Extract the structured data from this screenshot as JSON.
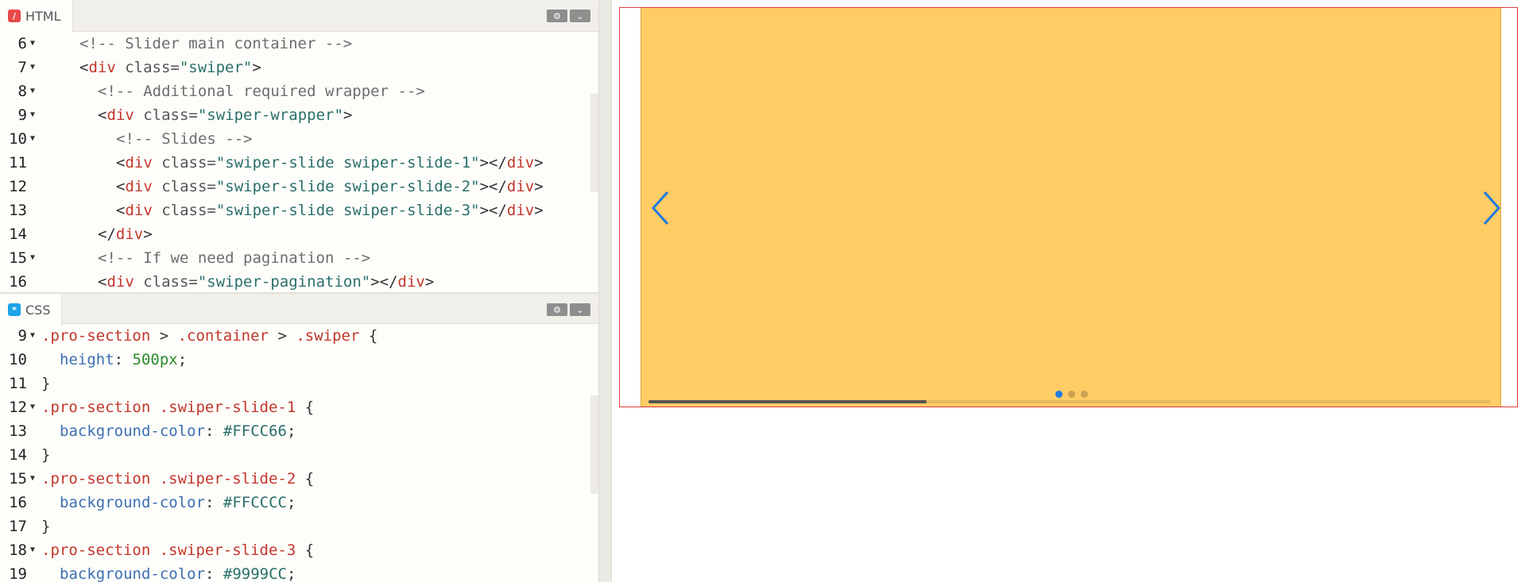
{
  "html_panel": {
    "tab_label": "HTML",
    "icon": "html-icon",
    "lines": [
      {
        "n": "6",
        "fold": true,
        "indent": 4,
        "parts": [
          [
            "c-comment",
            "<!-- Slider main container -->"
          ]
        ]
      },
      {
        "n": "7",
        "fold": true,
        "indent": 4,
        "parts": [
          [
            "c-punc",
            "<"
          ],
          [
            "c-tag",
            "div"
          ],
          [
            "c-attr",
            " class="
          ],
          [
            "c-str",
            "\"swiper\""
          ],
          [
            "c-punc",
            ">"
          ]
        ]
      },
      {
        "n": "8",
        "fold": true,
        "indent": 6,
        "parts": [
          [
            "c-comment",
            "<!-- Additional required wrapper -->"
          ]
        ]
      },
      {
        "n": "9",
        "fold": true,
        "indent": 6,
        "parts": [
          [
            "c-punc",
            "<"
          ],
          [
            "c-tag",
            "div"
          ],
          [
            "c-attr",
            " class="
          ],
          [
            "c-str",
            "\"swiper-wrapper\""
          ],
          [
            "c-punc",
            ">"
          ]
        ]
      },
      {
        "n": "10",
        "fold": true,
        "indent": 8,
        "parts": [
          [
            "c-comment",
            "<!-- Slides -->"
          ]
        ]
      },
      {
        "n": "11",
        "fold": false,
        "indent": 8,
        "parts": [
          [
            "c-punc",
            "<"
          ],
          [
            "c-tag",
            "div"
          ],
          [
            "c-attr",
            " class="
          ],
          [
            "c-str",
            "\"swiper-slide swiper-slide-1\""
          ],
          [
            "c-punc",
            "></"
          ],
          [
            "c-tag",
            "div"
          ],
          [
            "c-punc",
            ">"
          ]
        ]
      },
      {
        "n": "12",
        "fold": false,
        "indent": 8,
        "parts": [
          [
            "c-punc",
            "<"
          ],
          [
            "c-tag",
            "div"
          ],
          [
            "c-attr",
            " class="
          ],
          [
            "c-str",
            "\"swiper-slide swiper-slide-2\""
          ],
          [
            "c-punc",
            "></"
          ],
          [
            "c-tag",
            "div"
          ],
          [
            "c-punc",
            ">"
          ]
        ]
      },
      {
        "n": "13",
        "fold": false,
        "indent": 8,
        "parts": [
          [
            "c-punc",
            "<"
          ],
          [
            "c-tag",
            "div"
          ],
          [
            "c-attr",
            " class="
          ],
          [
            "c-str",
            "\"swiper-slide swiper-slide-3\""
          ],
          [
            "c-punc",
            "></"
          ],
          [
            "c-tag",
            "div"
          ],
          [
            "c-punc",
            ">"
          ]
        ]
      },
      {
        "n": "14",
        "fold": false,
        "indent": 6,
        "parts": [
          [
            "c-punc",
            "</"
          ],
          [
            "c-tag",
            "div"
          ],
          [
            "c-punc",
            ">"
          ]
        ]
      },
      {
        "n": "15",
        "fold": true,
        "indent": 6,
        "parts": [
          [
            "c-comment",
            "<!-- If we need pagination -->"
          ]
        ]
      },
      {
        "n": "16",
        "fold": false,
        "indent": 6,
        "parts": [
          [
            "c-punc",
            "<"
          ],
          [
            "c-tag",
            "div"
          ],
          [
            "c-attr",
            " class="
          ],
          [
            "c-str",
            "\"swiper-pagination\""
          ],
          [
            "c-punc",
            "></"
          ],
          [
            "c-tag",
            "div"
          ],
          [
            "c-punc",
            ">"
          ]
        ]
      }
    ]
  },
  "css_panel": {
    "tab_label": "CSS",
    "icon": "css-icon",
    "lines": [
      {
        "n": "9",
        "fold": true,
        "indent": 0,
        "parts": [
          [
            "c-sel",
            ".pro-section"
          ],
          [
            "c-punc",
            " > "
          ],
          [
            "c-sel",
            ".container"
          ],
          [
            "c-punc",
            " > "
          ],
          [
            "c-sel",
            ".swiper"
          ],
          [
            "c-punc",
            " {"
          ]
        ]
      },
      {
        "n": "10",
        "fold": false,
        "indent": 2,
        "parts": [
          [
            "c-prop",
            "height"
          ],
          [
            "c-punc",
            ": "
          ],
          [
            "c-num",
            "500px"
          ],
          [
            "c-punc",
            ";"
          ]
        ]
      },
      {
        "n": "11",
        "fold": false,
        "indent": 0,
        "parts": [
          [
            "c-punc",
            "}"
          ]
        ]
      },
      {
        "n": "12",
        "fold": true,
        "indent": 0,
        "parts": [
          [
            "c-sel",
            ".pro-section .swiper-slide-1"
          ],
          [
            "c-punc",
            " {"
          ]
        ]
      },
      {
        "n": "13",
        "fold": false,
        "indent": 2,
        "parts": [
          [
            "c-prop",
            "background-color"
          ],
          [
            "c-punc",
            ": "
          ],
          [
            "c-val",
            "#FFCC66"
          ],
          [
            "c-punc",
            ";"
          ]
        ]
      },
      {
        "n": "14",
        "fold": false,
        "indent": 0,
        "parts": [
          [
            "c-punc",
            "}"
          ]
        ]
      },
      {
        "n": "15",
        "fold": true,
        "indent": 0,
        "parts": [
          [
            "c-sel",
            ".pro-section .swiper-slide-2"
          ],
          [
            "c-punc",
            " {"
          ]
        ]
      },
      {
        "n": "16",
        "fold": false,
        "indent": 2,
        "parts": [
          [
            "c-prop",
            "background-color"
          ],
          [
            "c-punc",
            ": "
          ],
          [
            "c-val",
            "#FFCCCC"
          ],
          [
            "c-punc",
            ";"
          ]
        ]
      },
      {
        "n": "17",
        "fold": false,
        "indent": 0,
        "parts": [
          [
            "c-punc",
            "}"
          ]
        ]
      },
      {
        "n": "18",
        "fold": true,
        "indent": 0,
        "parts": [
          [
            "c-sel",
            ".pro-section .swiper-slide-3"
          ],
          [
            "c-punc",
            " {"
          ]
        ]
      },
      {
        "n": "19",
        "fold": false,
        "indent": 2,
        "parts": [
          [
            "c-prop",
            "background-color"
          ],
          [
            "c-punc",
            ": "
          ],
          [
            "c-val",
            "#9999CC"
          ],
          [
            "c-punc",
            ";"
          ]
        ]
      }
    ]
  },
  "controls": {
    "settings_icon": "gear-icon",
    "collapse_icon": "chevron-down-icon"
  },
  "preview": {
    "slide_color": "#FFCC66",
    "arrow_color": "#1e7be0",
    "prev_icon": "chevron-left-icon",
    "next_icon": "chevron-right-icon",
    "pagination": {
      "count": 3,
      "active": 0
    },
    "scroll_progress": 0.33
  }
}
